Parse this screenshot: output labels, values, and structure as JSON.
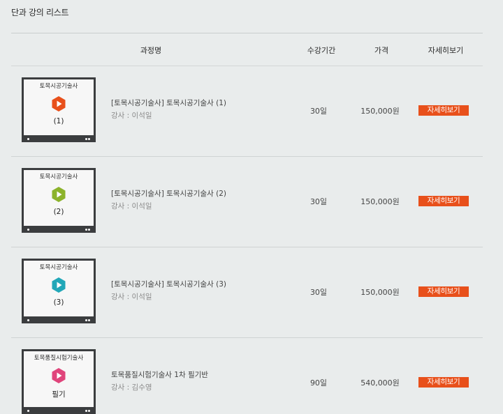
{
  "page": {
    "title": "단과 강의 리스트"
  },
  "table": {
    "headers": {
      "name": "과정명",
      "period": "수강기간",
      "price": "가격",
      "detail": "자세히보기"
    },
    "rows": [
      {
        "thumb_title": "토목시공기술사",
        "thumb_label": "(1)",
        "play_color": "#e8501b",
        "course_title": "[토목시공기술사] 토목시공기술사 (1)",
        "instructor": "강사 : 이석일",
        "period": "30일",
        "price": "150,000원",
        "button": "자세히보기"
      },
      {
        "thumb_title": "토목시공기술사",
        "thumb_label": "(2)",
        "play_color": "#8cb32b",
        "course_title": "[토목시공기술사] 토목시공기술사 (2)",
        "instructor": "강사 : 이석일",
        "period": "30일",
        "price": "150,000원",
        "button": "자세히보기"
      },
      {
        "thumb_title": "토목시공기술사",
        "thumb_label": "(3)",
        "play_color": "#21a7b8",
        "course_title": "[토목시공기술사] 토목시공기술사 (3)",
        "instructor": "강사 : 이석일",
        "period": "30일",
        "price": "150,000원",
        "button": "자세히보기"
      },
      {
        "thumb_title": "토목품질시험기술사",
        "thumb_label": "필기",
        "play_color": "#e0447b",
        "course_title": "토목품질시험기술사 1차 필기반",
        "instructor": "강사 : 김수영",
        "period": "90일",
        "price": "540,000원",
        "button": "자세히보기"
      }
    ]
  },
  "colors": {
    "button": "#e8501b",
    "background": "#e9ecec"
  }
}
